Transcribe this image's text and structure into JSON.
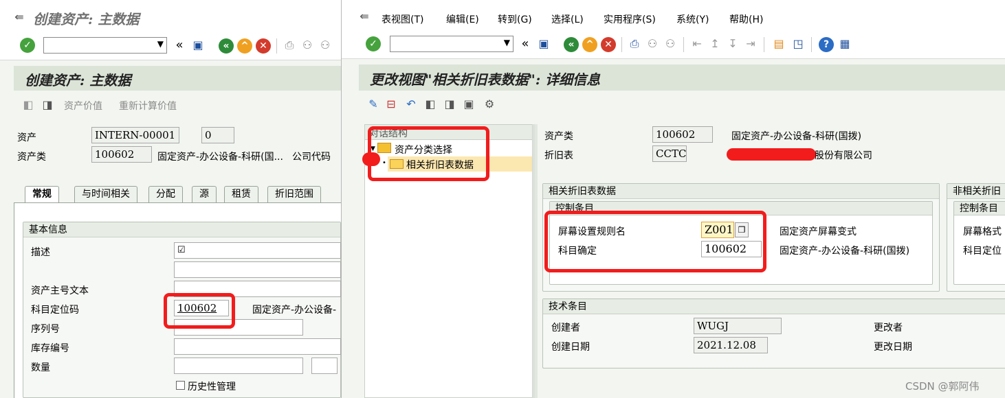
{
  "left": {
    "window_title": "创建资产: 主数据",
    "screen_title": "创建资产: 主数据",
    "app_toolbar": {
      "asset_values": "资产价值",
      "recalculate": "重新计算价值"
    },
    "header": {
      "asset_label": "资产",
      "asset_number": "INTERN-00001",
      "asset_sub": "0",
      "class_label": "资产类",
      "class_value": "100602",
      "class_desc": "固定资产-办公设备-科研(国...",
      "company_code_label": "公司代码"
    },
    "tabs": [
      "常规",
      "与时间相关",
      "分配",
      "源",
      "租赁",
      "折旧范围"
    ],
    "basic_info": {
      "title": "基本信息",
      "desc_label": "描述",
      "desc_value": "☑",
      "main_text_label": "资产主号文本",
      "acct_det_label": "科目定位码",
      "acct_det_value": "100602",
      "acct_det_desc": "固定资产-办公设备-",
      "serial_label": "序列号",
      "inventory_label": "库存编号",
      "quantity_label": "数量",
      "history_label": "历史性管理"
    }
  },
  "right": {
    "menu": [
      "表视图(T)",
      "编辑(E)",
      "转到(G)",
      "选择(L)",
      "实用程序(S)",
      "系统(Y)",
      "帮助(H)"
    ],
    "screen_title": "更改视图\"相关折旧表数据\": 详细信息",
    "tree": {
      "header": "对话结构",
      "items": [
        "资产分类选择",
        "相关折旧表数据"
      ]
    },
    "header": {
      "class_label": "资产类",
      "class_value": "100602",
      "class_desc": "固定资产-办公设备-科研(国拨)",
      "chart_label": "折旧表",
      "chart_value": "CCTC",
      "chart_desc": "股份有限公司"
    },
    "dep_data": {
      "title": "相关折旧表数据",
      "control_title": "控制条目",
      "layout_label": "屏幕设置规则名",
      "layout_value": "Z001",
      "layout_desc": "固定资产屏幕变式",
      "acct_label": "科目确定",
      "acct_value": "100602",
      "acct_desc": "固定资产-办公设备-科研(国拨)"
    },
    "non_dep_data": {
      "title": "非相关折旧",
      "control_title": "控制条目",
      "layout_label": "屏幕格式",
      "acct_label": "科目定位"
    },
    "tech": {
      "title": "技术条目",
      "created_by_label": "创建者",
      "created_by_value": "WUGJ",
      "created_on_label": "创建日期",
      "created_on_value": "2021.12.08",
      "changed_by_label": "更改者",
      "changed_on_label": "更改日期"
    },
    "watermark": "CSDN @郭阿伟"
  },
  "colors": {
    "red_annotation": "#f21c1c",
    "title_bg": "#dbe4d7",
    "header_bg": "#e7ede4"
  }
}
